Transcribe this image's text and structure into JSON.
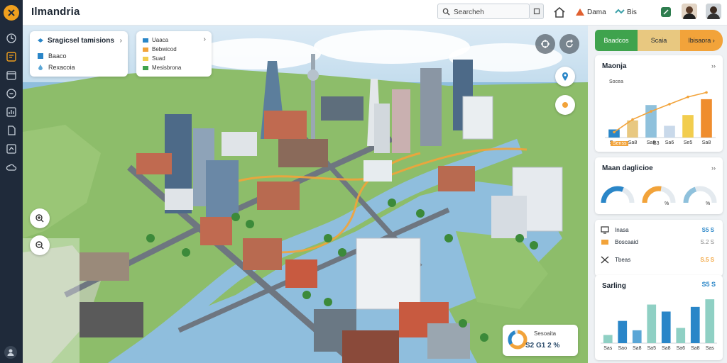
{
  "app": {
    "title": "Ilmandria"
  },
  "search": {
    "value": "Searcheh"
  },
  "topbar": {
    "items": [
      {
        "label": "Dama",
        "icon": "pin-icon"
      },
      {
        "label": "Bis",
        "icon": "signal-icon"
      }
    ]
  },
  "layers_card": {
    "title": "Sragicsel tamisions",
    "rows": [
      "Baaco",
      "Rexacoia"
    ]
  },
  "legend_card": {
    "rows": [
      "Uaaca",
      "Bebwicod",
      "Suad",
      "Mesisbrona"
    ]
  },
  "stat_card": {
    "label": "Sesoaita",
    "value": "S2 G1 2 %"
  },
  "panel": {
    "tabs": [
      {
        "label": "Baadcos",
        "color": "#3fa34d"
      },
      {
        "label": "Scaia",
        "color": "#e8c880"
      },
      {
        "label": "Ibisaora",
        "color": "#f2a33a"
      }
    ],
    "chart1": {
      "title": "Maonja",
      "series_label": "Socea",
      "x_labels": [
        "Sao",
        "Sa8",
        "Sa8",
        "Sa6",
        "Se5",
        "Sa8"
      ],
      "highlight_label": "Senss",
      "sub_label": "B3"
    },
    "gauges": {
      "title": "Maan daglicioe",
      "items": [
        {
          "label": "",
          "color": "#2a86c8",
          "fraction": 0.62
        },
        {
          "label": "%",
          "color": "#f2a33a",
          "fraction": 0.55
        },
        {
          "label": "%",
          "color": "#8fc1dc",
          "fraction": 0.4
        }
      ]
    },
    "list": [
      {
        "name": "Inasa",
        "value": "S5 S",
        "icon": "monitor-icon",
        "color": "#2a86c8"
      },
      {
        "name": "Boscaaid",
        "value": "S.2 S",
        "icon": "layers-icon",
        "color": "#f2a33a"
      },
      {
        "name": "Tbeas",
        "value": "S.5 S",
        "icon": "arrows-icon",
        "color": "#f2a33a"
      }
    ],
    "chart2": {
      "title": "Sarling",
      "value": "S5 S",
      "x_labels": [
        "Sas",
        "Sao",
        "Sa8",
        "Sa5",
        "Sa8",
        "Sa6",
        "Sa8",
        "Sas"
      ]
    }
  },
  "chart_data": [
    {
      "type": "bar",
      "categories": [
        "Sao",
        "Sa8",
        "Sa8",
        "Sa6",
        "Se5",
        "Sa8"
      ],
      "series": [
        {
          "values": [
            18,
            38,
            72,
            26,
            50,
            85
          ],
          "colors": [
            "#2a86c8",
            "#e8c880",
            "#8fc1dc",
            "#c9d9ea",
            "#f2cd4e",
            "#ef8d2e"
          ]
        }
      ],
      "line": [
        12,
        40,
        58,
        74,
        90,
        100
      ],
      "ylim": [
        0,
        110
      ]
    },
    {
      "type": "bar",
      "categories": [
        "Sas",
        "Sao",
        "Sa8",
        "Sa5",
        "Sa8",
        "Sa6",
        "Sa8",
        "Sas"
      ],
      "series": [
        {
          "values": [
            14,
            38,
            22,
            66,
            54,
            26,
            62,
            75
          ],
          "colors": [
            "#8fd0c4",
            "#2a86c8",
            "#5aa6d6",
            "#8fd0c4",
            "#2a86c8",
            "#8fd0c4",
            "#2a86c8",
            "#8fd0c4"
          ]
        }
      ],
      "ylim": [
        0,
        80
      ]
    }
  ]
}
